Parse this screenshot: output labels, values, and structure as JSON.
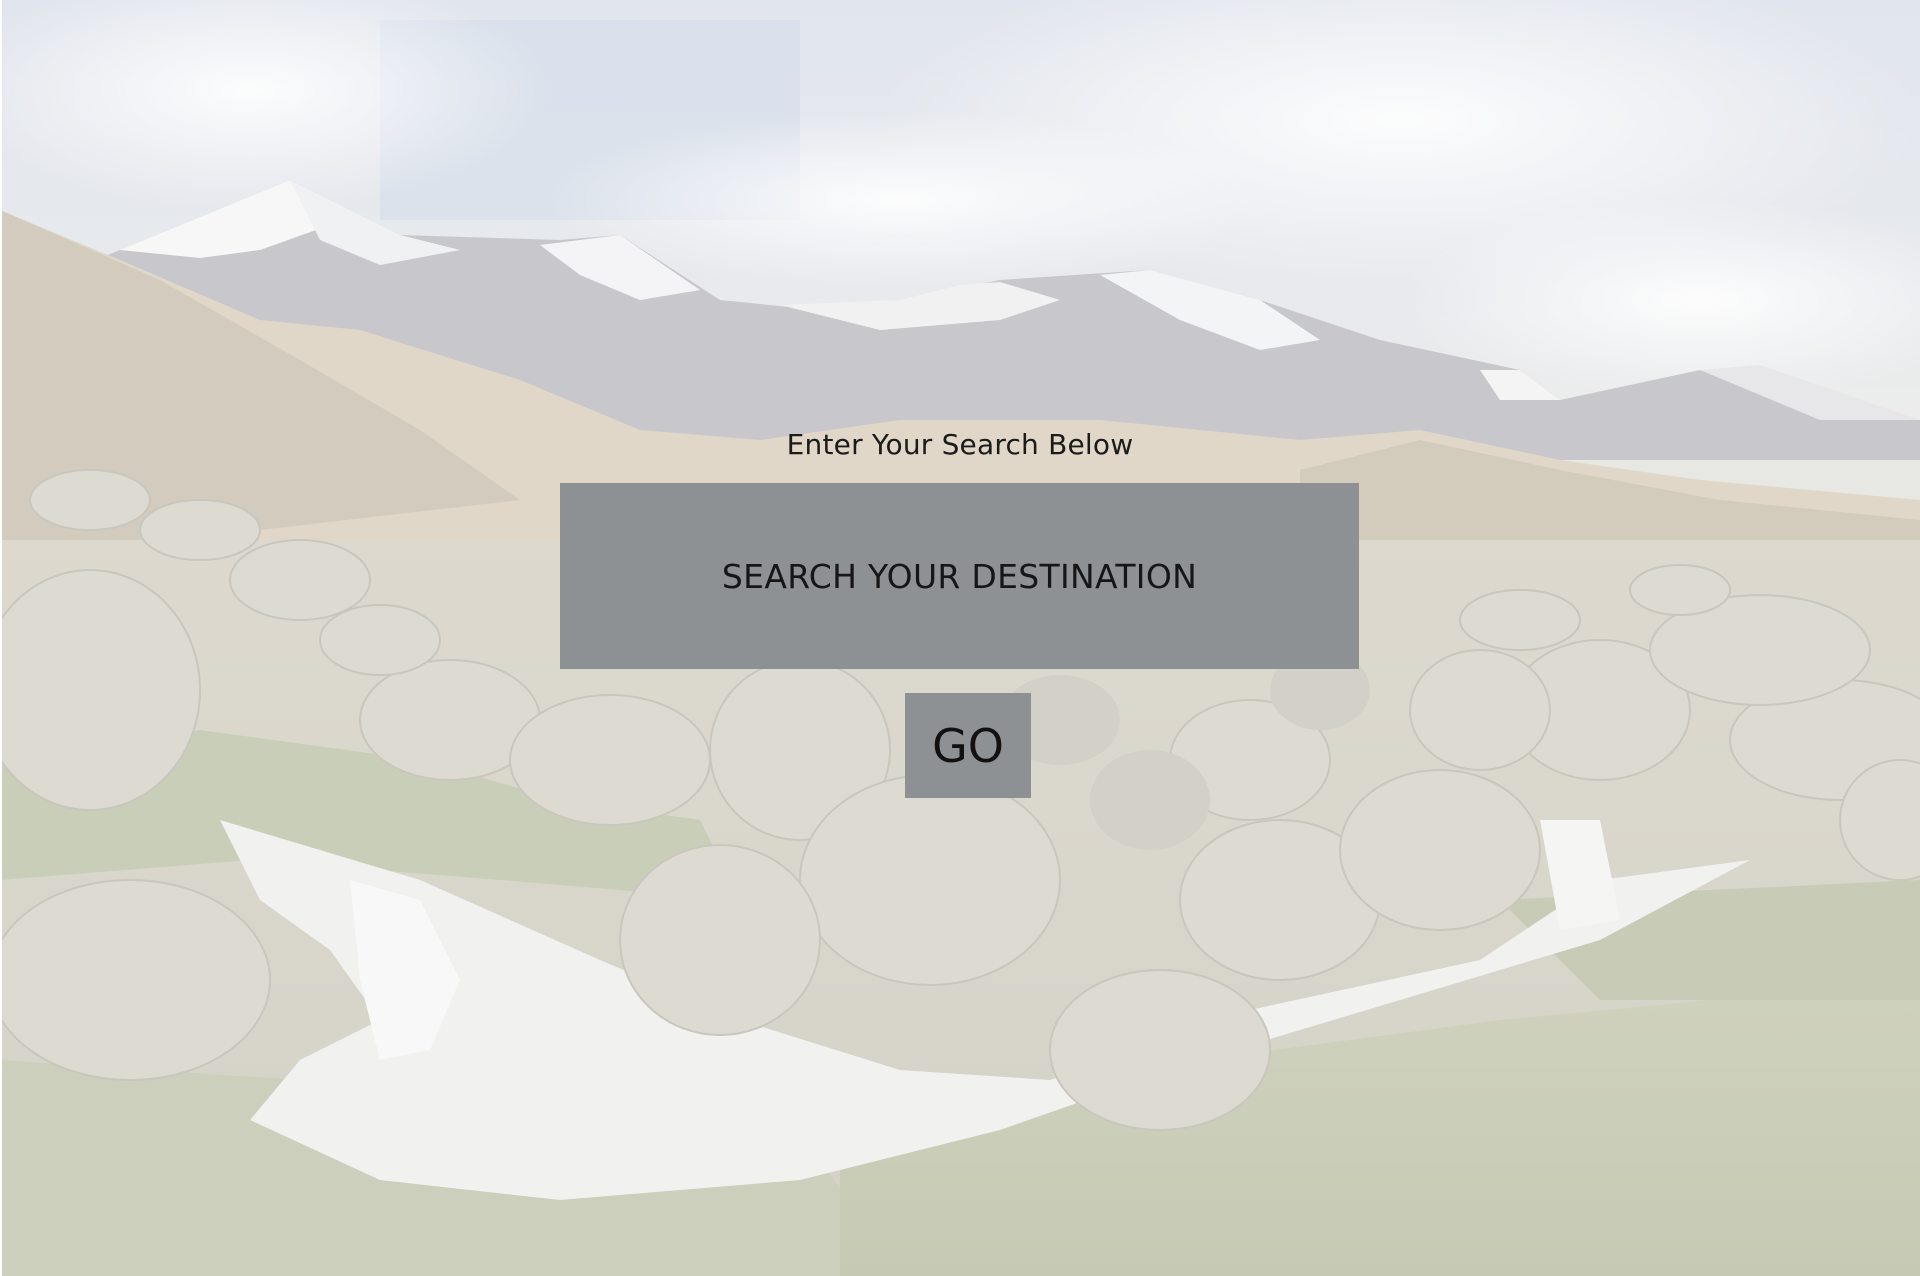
{
  "search": {
    "heading": "Enter Your Search Below",
    "placeholder": "SEARCH YOUR DESTINATION",
    "value": "",
    "go_label": "GO"
  },
  "background": {
    "description_icon": "mountain-stream-landscape",
    "sky_color": "#c9d3df",
    "snow_color": "#f1f1f1",
    "rock_color": "#c4bfb2",
    "grass_color": "#a7ad8a",
    "water_color": "#e6e8e6"
  },
  "colors": {
    "field_bg": "#8e9194",
    "text": "#161616"
  }
}
